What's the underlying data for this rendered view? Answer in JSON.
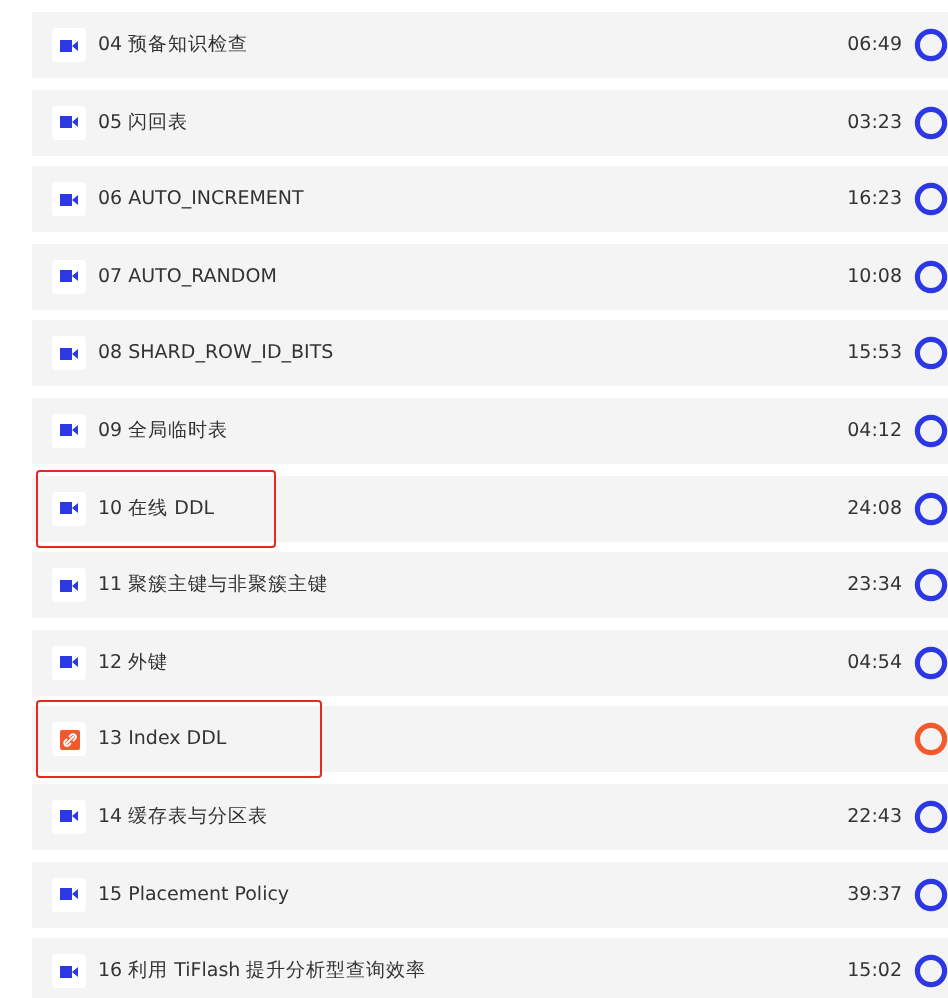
{
  "lessons": [
    {
      "kind": "video",
      "title": "04 预备知识检查",
      "duration": "06:49",
      "highlighted": false
    },
    {
      "kind": "video",
      "title": "05 闪回表",
      "duration": "03:23",
      "highlighted": false
    },
    {
      "kind": "video",
      "title": "06 AUTO_INCREMENT",
      "duration": "16:23",
      "highlighted": false
    },
    {
      "kind": "video",
      "title": "07 AUTO_RANDOM",
      "duration": "10:08",
      "highlighted": false
    },
    {
      "kind": "video",
      "title": "08 SHARD_ROW_ID_BITS",
      "duration": "15:53",
      "highlighted": false
    },
    {
      "kind": "video",
      "title": "09 全局临时表",
      "duration": "04:12",
      "highlighted": false
    },
    {
      "kind": "video",
      "title": "10 在线 DDL",
      "duration": "24:08",
      "highlighted": true
    },
    {
      "kind": "video",
      "title": "11 聚簇主键与非聚簇主键",
      "duration": "23:34",
      "highlighted": false
    },
    {
      "kind": "video",
      "title": "12 外键",
      "duration": "04:54",
      "highlighted": false
    },
    {
      "kind": "link",
      "title": "13 Index DDL",
      "highlighted": true
    },
    {
      "kind": "video",
      "title": "14 缓存表与分区表",
      "duration": "22:43",
      "highlighted": false
    },
    {
      "kind": "video",
      "title": "15 Placement Policy",
      "duration": "39:37",
      "highlighted": false
    },
    {
      "kind": "video",
      "title": "16 利用 TiFlash 提升分析型查询效率",
      "duration": "15:02",
      "highlighted": false
    }
  ]
}
